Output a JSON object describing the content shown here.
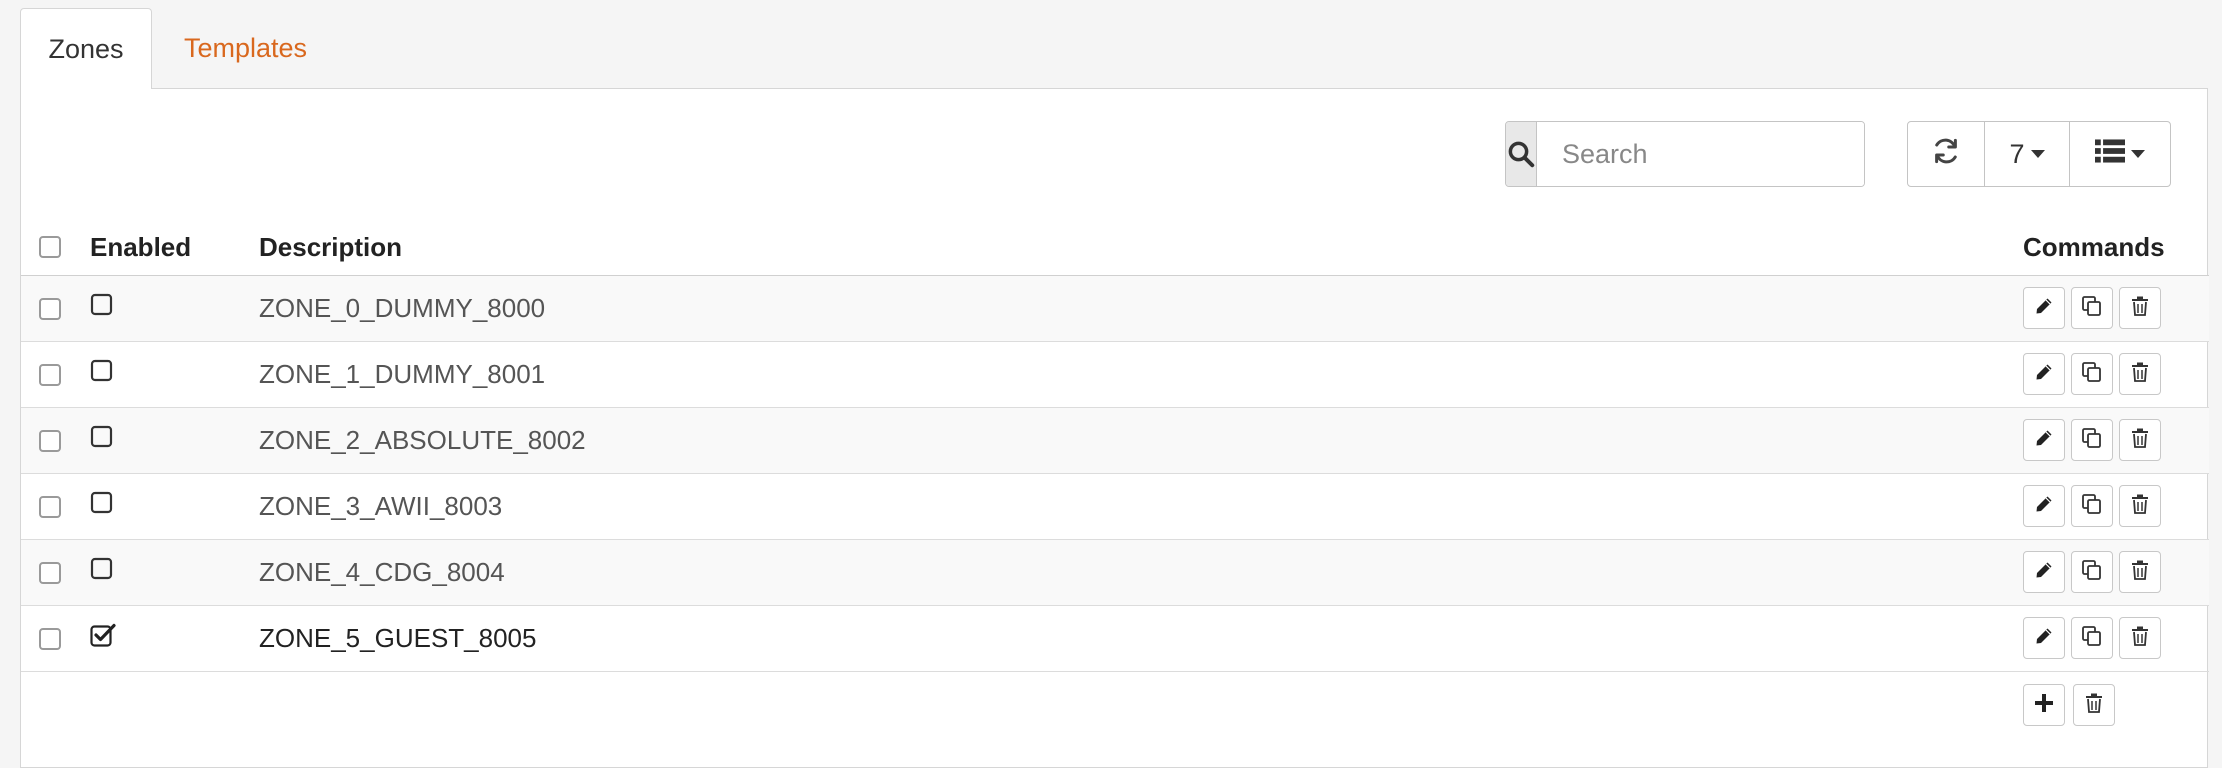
{
  "tabs": [
    {
      "label": "Zones",
      "active": true
    },
    {
      "label": "Templates",
      "active": false
    }
  ],
  "toolbar": {
    "search_placeholder": "Search",
    "page_size": "7",
    "icons": [
      "search-icon",
      "refresh-icon",
      "chevron-down-icon",
      "list-icon"
    ]
  },
  "table": {
    "columns": {
      "enabled": "Enabled",
      "description": "Description",
      "commands": "Commands"
    },
    "rows": [
      {
        "description": "ZONE_0_DUMMY_8000",
        "enabled": false
      },
      {
        "description": "ZONE_1_DUMMY_8001",
        "enabled": false
      },
      {
        "description": "ZONE_2_ABSOLUTE_8002",
        "enabled": false
      },
      {
        "description": "ZONE_3_AWII_8003",
        "enabled": false
      },
      {
        "description": "ZONE_4_CDG_8004",
        "enabled": false
      },
      {
        "description": "ZONE_5_GUEST_8005",
        "enabled": true
      }
    ],
    "row_command_icons": [
      "pencil-icon",
      "copy-icon",
      "trash-icon"
    ],
    "footer_command_icons": [
      "plus-icon",
      "trash-icon"
    ]
  },
  "colors": {
    "accent": "#d9681e",
    "background": "#f5f5f5",
    "panel": "#ffffff",
    "border": "#d6d6d6"
  }
}
